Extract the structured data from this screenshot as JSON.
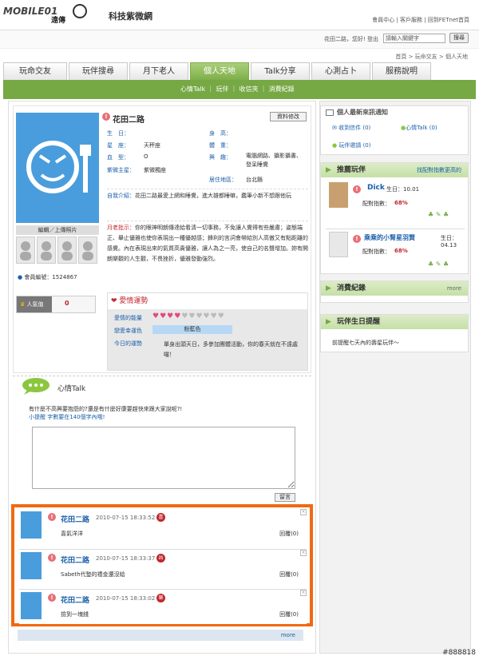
{
  "logo": {
    "text": "MOBILE01",
    "sub": "遠傳"
  },
  "site_title": "科技紫微網",
  "top_links": [
    "會員中心",
    "客戶服務",
    "回到FETnet首頁"
  ],
  "welcome": "花田二路，您好! 登出",
  "search": {
    "value": "請輸入關鍵字",
    "button": "搜尋"
  },
  "breadcrumb": [
    "首頁",
    "玩命交友",
    "個人天地"
  ],
  "tabs": [
    "玩命交友",
    "玩伴搜尋",
    "月下老人",
    "個人天地",
    "Talk分享",
    "心測占卜",
    "服務說明"
  ],
  "subnav": [
    "心情Talk",
    "玩伴",
    "收信夾",
    "消費紀錄"
  ],
  "profile": {
    "name": "花田二路",
    "edit": "資料修改",
    "fields": [
      {
        "k": "生　日：",
        "v": ""
      },
      {
        "k": "星　座：",
        "v": "天秤座"
      },
      {
        "k": "血　型：",
        "v": "O"
      },
      {
        "k": "紫微主星：",
        "v": "紫微獨座"
      }
    ],
    "fields2": [
      {
        "k": "身　高：",
        "v": ""
      },
      {
        "k": "體　重：",
        "v": ""
      },
      {
        "k": "興　趣：",
        "v": "電腦網路、攝影攝書、發呆睡覺"
      },
      {
        "k": "居住地區：",
        "v": "台北縣"
      }
    ],
    "intro_label": "自我介紹：",
    "intro": "花田二路最愛上網和睡覺，進大雄都睡嘛，蠢筆小新不想跟他玩",
    "moon_label": "月老批示：",
    "moon": "你的眼神明朗傳達給看清一切事務，不免讓人覺得有些嚴肅；姿態端正、舉止優雅也使你表現出一種優越感；鋒利的言詞會帶給別人高傲又有點距離的感覺。內在表現出來的氣質高貴優雅，讓人為之一亮，使自己的名聲增加。妳有開朗樂觀的人生觀，不畏挫折，優雅發動強烈。",
    "avatar_caption": "編輯／上傳照片",
    "member_no": "會員編號：1524867",
    "popularity_label": "人氣值",
    "popularity": "0"
  },
  "love": {
    "title": "愛情運勢",
    "rows": [
      {
        "k": "愛情的能量",
        "v": ""
      },
      {
        "k": "戀愛幸運色",
        "v": "粉藍色"
      },
      {
        "k": "今日的運勢",
        "v": "單身出頭天日，多參加團體活動，你的春天就在不遠處囉！"
      }
    ],
    "hearts_filled": 4,
    "hearts_total": 10
  },
  "talk": {
    "title": "心情Talk",
    "prompt": "有什麼不高興要抱怨的?還是有什麼好康要趕快來跟大家說呢?!",
    "hint": "小提醒 字數要在140個字內哦!",
    "button": "留言"
  },
  "posts": [
    {
      "name": "花田二路",
      "date": "2010-07-15 18:33:52",
      "mood": "喜",
      "text": "喜氣洋洋",
      "reply": "回覆(0)"
    },
    {
      "name": "花田二路",
      "date": "2010-07-15 18:33:37",
      "mood": "凶",
      "text": "Sabeth代墊的禮金還沒給",
      "reply": "回覆(0)"
    },
    {
      "name": "花田二路",
      "date": "2010-07-15 18:33:02",
      "mood": "樂",
      "text": "撿到一塊錢",
      "reply": "回覆(0)"
    }
  ],
  "more": "more",
  "notify": {
    "title": "個人最新來訊通知",
    "mail": "收到信件 (0)",
    "talk": "心情Talk (0)",
    "invite": "玩伴邀請 (0)"
  },
  "recommend": {
    "title": "推薦玩伴",
    "hint": "找配對指數更高的",
    "items": [
      {
        "name": "Dick",
        "birthday": "生日：10.01",
        "score_label": "配對指數：",
        "score": "68%"
      },
      {
        "name": "乘乘的小腎星羽賢",
        "birthday": "生日：04.13",
        "score_label": "配對指數：",
        "score": "68%"
      }
    ]
  },
  "consume": {
    "title": "消費紀錄",
    "more": "more"
  },
  "birthday": {
    "title": "玩伴生日提醒",
    "text": "前提醒七天內的壽星玩伴～"
  },
  "watermark": "#888818"
}
